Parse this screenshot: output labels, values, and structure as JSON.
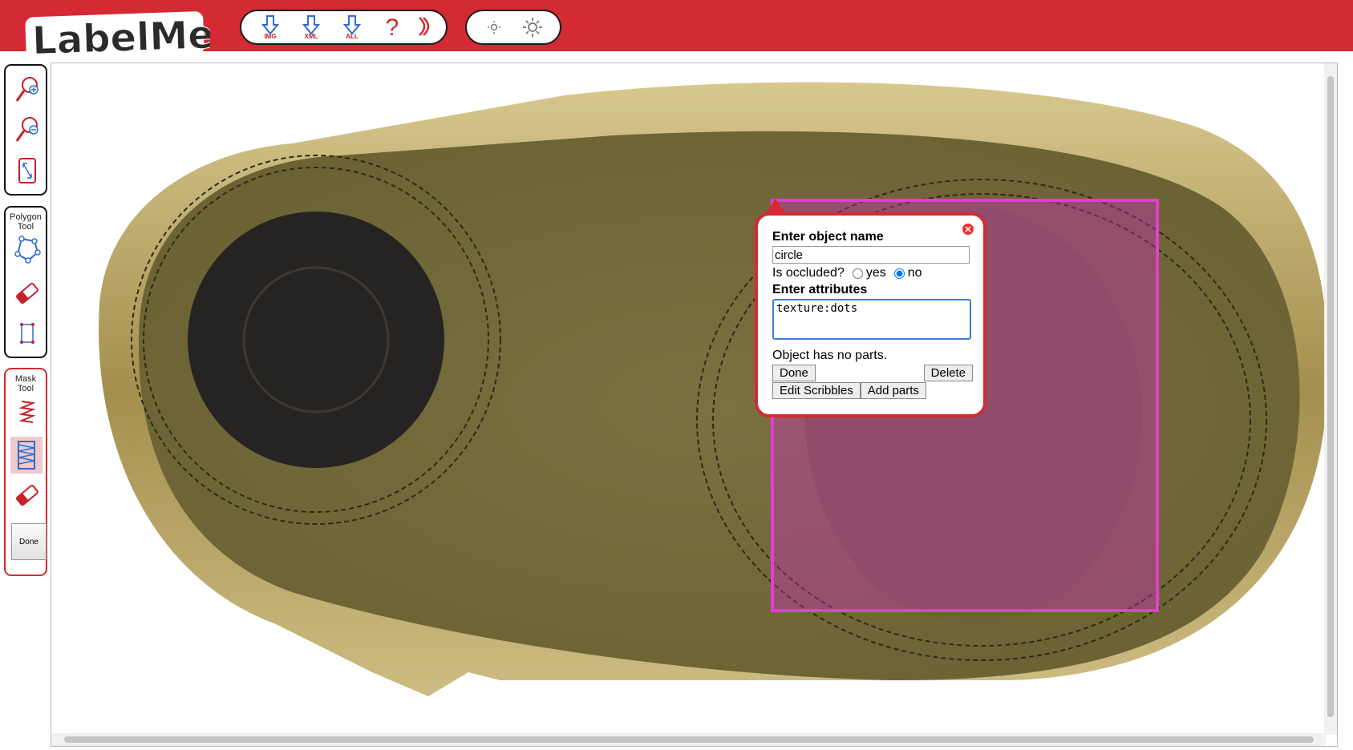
{
  "app": {
    "logo_text": "LabelMe"
  },
  "toolbar": {
    "download_img": "IMG",
    "download_xml": "XML",
    "download_all": "ALL",
    "help": "?",
    "sign_out": "⟩⟩",
    "brightness_down": "brightness-low-icon",
    "brightness_up": "brightness-high-icon"
  },
  "sidebar": {
    "polygon_tool_label": "Polygon\nTool",
    "mask_tool_label": "Mask\nTool",
    "done_label": "Done"
  },
  "popup": {
    "name_label": "Enter object name",
    "name_value": "circle",
    "occluded_label": "Is occluded?",
    "occluded_yes": "yes",
    "occluded_no": "no",
    "occluded_selected": "no",
    "attributes_label": "Enter attributes",
    "attributes_value": "texture:dots",
    "parts_text": "Object has no parts.",
    "done_button": "Done",
    "delete_button": "Delete",
    "edit_scribbles_button": "Edit Scribbles",
    "add_parts_button": "Add parts"
  },
  "colors": {
    "brand_red": "#d32a33",
    "selection_magenta": "#e13fd0"
  }
}
